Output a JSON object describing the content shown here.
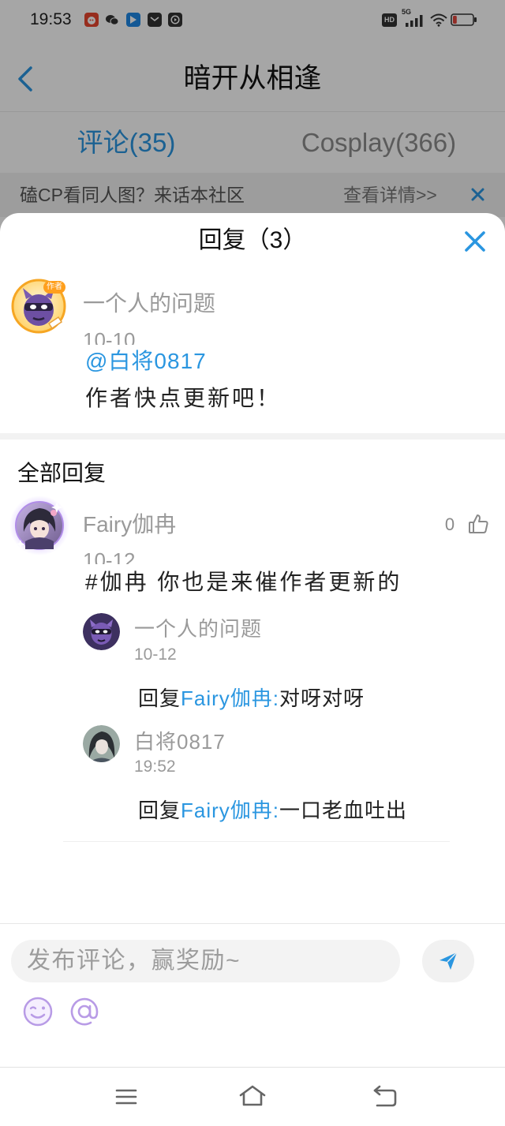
{
  "status_bar": {
    "time": "19:53",
    "notification_icons": [
      "red-app-icon",
      "wechat-icon",
      "blue-app-icon",
      "mail-icon",
      "media-icon"
    ],
    "hd_label": "HD",
    "network_label": "5G",
    "battery_level": 0.2
  },
  "header": {
    "back_icon": "chevron-left-icon",
    "title": "暗开从相逢"
  },
  "tabs": [
    {
      "label": "评论(35)",
      "active": true
    },
    {
      "label": "Cosplay(366)",
      "active": false
    }
  ],
  "banner": {
    "text": "磕CP看同人图？来话本社区",
    "link_label": "查看详情>>",
    "close_icon": "close-icon"
  },
  "sheet": {
    "title": "回复（3）",
    "close_icon": "close-icon",
    "original_comment": {
      "user": "一个人的问题",
      "badge": "作者",
      "date": "10-10",
      "mention": "@白将0817",
      "content": "作者快点更新吧！"
    },
    "all_replies_label": "全部回复",
    "replies": [
      {
        "user": "Fairy伽冉",
        "date": "10-12",
        "likes": "0",
        "like_icon": "thumbs-up-icon",
        "content": "#伽冉 你也是来催作者更新的",
        "sub_replies": [
          {
            "user": "一个人的问题",
            "date": "10-12",
            "reply_prefix": "回复",
            "reply_target": "Fairy伽冉:",
            "text": "对呀对呀"
          },
          {
            "user": "白将0817",
            "date": "19:52",
            "reply_prefix": "回复",
            "reply_target": "Fairy伽冉:",
            "text": "一口老血吐出"
          }
        ]
      }
    ]
  },
  "composer": {
    "placeholder": "发布评论，赢奖励~",
    "send_icon": "send-icon",
    "emoji_icon": "emoji-icon",
    "mention_icon": "at-icon"
  },
  "nav_bar": {
    "icons": [
      "menu-icon",
      "home-icon",
      "back-icon"
    ]
  },
  "colors": {
    "accent": "#2a96e0",
    "text_primary": "#222222",
    "text_secondary": "#9a9a9a",
    "icon_lavender": "#b89be6",
    "battery_low": "#e0463c",
    "overlay": "rgba(0,0,0,0.35)"
  }
}
